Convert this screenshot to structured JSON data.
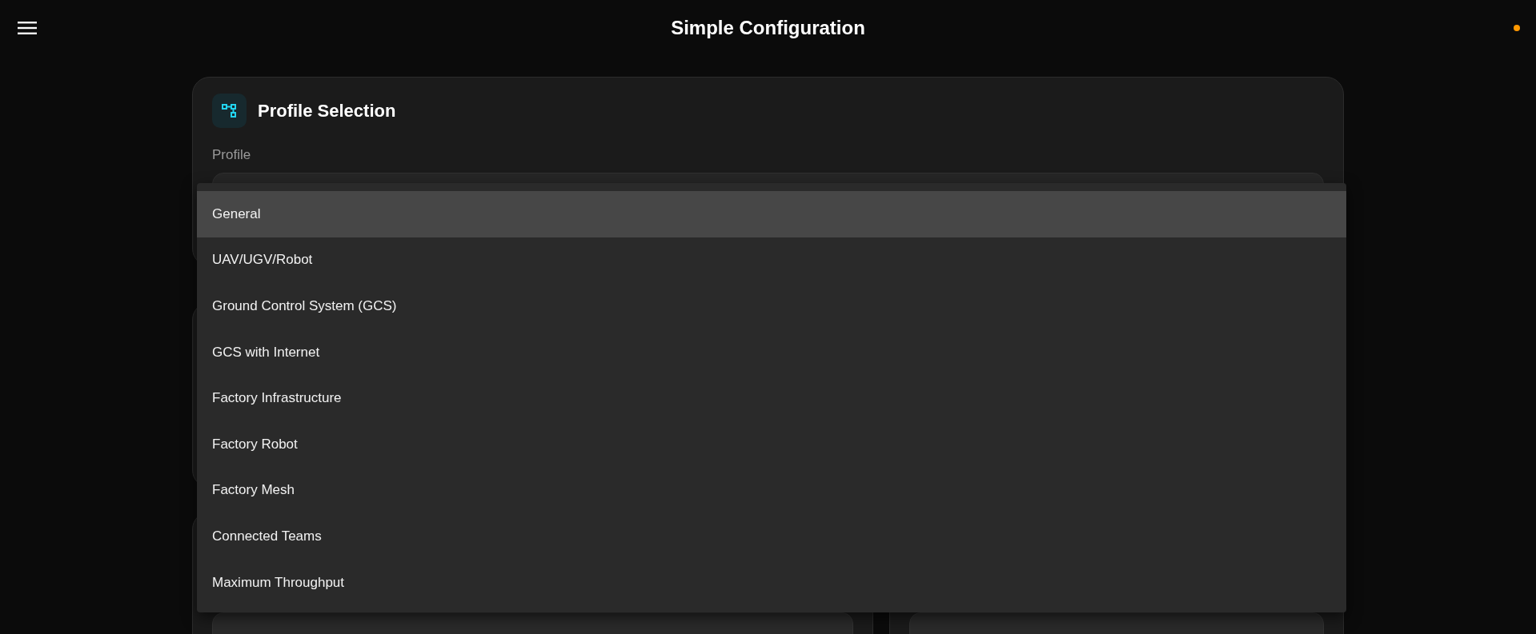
{
  "header": {
    "title": "Simple Configuration"
  },
  "profile_card": {
    "title": "Profile Selection",
    "field_label": "Profile"
  },
  "profile_menu": {
    "options": [
      {
        "label": "General",
        "selected": true
      },
      {
        "label": "UAV/UGV/Robot",
        "selected": false
      },
      {
        "label": "Ground Control System (GCS)",
        "selected": false
      },
      {
        "label": "GCS with Internet",
        "selected": false
      },
      {
        "label": "Factory Infrastructure",
        "selected": false
      },
      {
        "label": "Factory Robot",
        "selected": false
      },
      {
        "label": "Factory Mesh",
        "selected": false
      },
      {
        "label": "Connected Teams",
        "selected": false
      },
      {
        "label": "Maximum Throughput",
        "selected": false
      }
    ]
  }
}
